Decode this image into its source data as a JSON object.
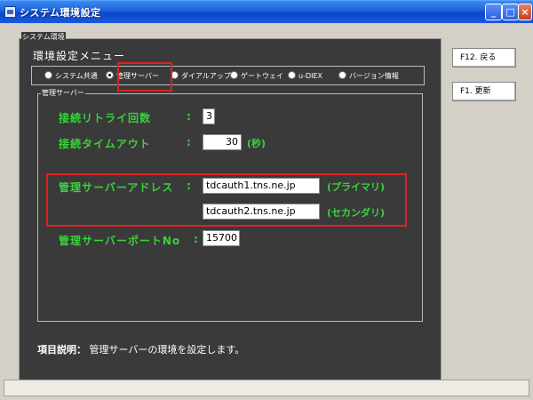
{
  "window": {
    "title": "システム環境設定",
    "min": "_",
    "max": "□",
    "close": "×"
  },
  "panel": {
    "legend": "システム環境",
    "menu_title": "環境設定メニュー"
  },
  "radio_options": [
    {
      "label": "システム共通",
      "selected": false
    },
    {
      "label": "管理サーバー",
      "selected": true
    },
    {
      "label": "ダイアルアップ",
      "selected": false
    },
    {
      "label": "ゲートウェイ",
      "selected": false
    },
    {
      "label": "u-DIEX",
      "selected": false
    },
    {
      "label": "バージョン情報",
      "selected": false
    }
  ],
  "server": {
    "legend": "管理サーバー",
    "colon": ":",
    "retry_label": "接続リトライ回数",
    "retry_value": "3",
    "timeout_label": "接続タイムアウト",
    "timeout_value": "30",
    "timeout_unit": "(秒)",
    "address_label": "管理サーバーアドレス",
    "primary_value": "tdcauth1.tns.ne.jp",
    "primary_tag": "(プライマリ)",
    "secondary_value": "tdcauth2.tns.ne.jp",
    "secondary_tag": "(セカンダリ)",
    "port_label": "管理サーバーポートNo",
    "port_value": "15700"
  },
  "description": {
    "label": "項目説明：",
    "text": "管理サーバーの環境を設定します。"
  },
  "buttons": {
    "back": "F12. 戻る",
    "update": "F1. 更新"
  }
}
